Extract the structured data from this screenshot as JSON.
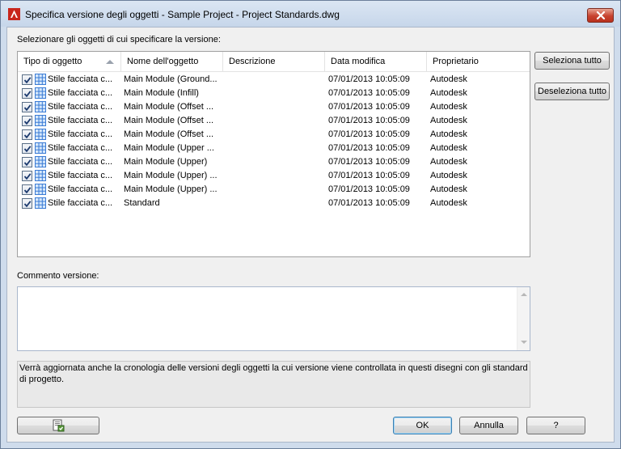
{
  "window": {
    "title": "Specifica versione degli oggetti - Sample Project - Project Standards.dwg"
  },
  "list_label": "Selezionare gli oggetti di cui specificare la versione:",
  "table": {
    "columns": [
      "Tipo di oggetto",
      "Nome dell'oggetto",
      "Descrizione",
      "Data modifica",
      "Proprietario"
    ],
    "sorted_column": "Tipo di oggetto",
    "rows": [
      {
        "checked": true,
        "type": "Stile facciata c...",
        "name": "Main Module (Ground...",
        "desc": "",
        "date": "07/01/2013 10:05:09",
        "owner": "Autodesk"
      },
      {
        "checked": true,
        "type": "Stile facciata c...",
        "name": "Main Module (Infill)",
        "desc": "",
        "date": "07/01/2013 10:05:09",
        "owner": "Autodesk"
      },
      {
        "checked": true,
        "type": "Stile facciata c...",
        "name": "Main Module (Offset ...",
        "desc": "",
        "date": "07/01/2013 10:05:09",
        "owner": "Autodesk"
      },
      {
        "checked": true,
        "type": "Stile facciata c...",
        "name": "Main Module (Offset ...",
        "desc": "",
        "date": "07/01/2013 10:05:09",
        "owner": "Autodesk"
      },
      {
        "checked": true,
        "type": "Stile facciata c...",
        "name": "Main Module (Offset ...",
        "desc": "",
        "date": "07/01/2013 10:05:09",
        "owner": "Autodesk"
      },
      {
        "checked": true,
        "type": "Stile facciata c...",
        "name": "Main Module (Upper ...",
        "desc": "",
        "date": "07/01/2013 10:05:09",
        "owner": "Autodesk"
      },
      {
        "checked": true,
        "type": "Stile facciata c...",
        "name": "Main Module (Upper)",
        "desc": "",
        "date": "07/01/2013 10:05:09",
        "owner": "Autodesk"
      },
      {
        "checked": true,
        "type": "Stile facciata c...",
        "name": "Main Module (Upper) ...",
        "desc": "",
        "date": "07/01/2013 10:05:09",
        "owner": "Autodesk"
      },
      {
        "checked": true,
        "type": "Stile facciata c...",
        "name": "Main Module (Upper) ...",
        "desc": "",
        "date": "07/01/2013 10:05:09",
        "owner": "Autodesk"
      },
      {
        "checked": true,
        "type": "Stile facciata c...",
        "name": "Standard",
        "desc": "",
        "date": "07/01/2013 10:05:09",
        "owner": "Autodesk"
      }
    ]
  },
  "buttons": {
    "select_all": "Seleziona tutto",
    "deselect_all": "Deseleziona tutto",
    "ok": "OK",
    "cancel": "Annulla",
    "help": "?"
  },
  "comment": {
    "label": "Commento versione:",
    "value": ""
  },
  "info_text": "Verrà aggiornata anche la cronologia delle versioni degli oggetti la cui versione viene controllata in questi disegni con gli standard di progetto.",
  "icons": {
    "app": "autocad-architecture-icon",
    "close": "close-icon",
    "row_type": "curtain-wall-style-icon",
    "bottom_left": "compare-document-icon"
  },
  "colors": {
    "close_button": "#c7432f",
    "icon_blue": "#3a7bd5",
    "checkmark": "#1c3a6e"
  }
}
